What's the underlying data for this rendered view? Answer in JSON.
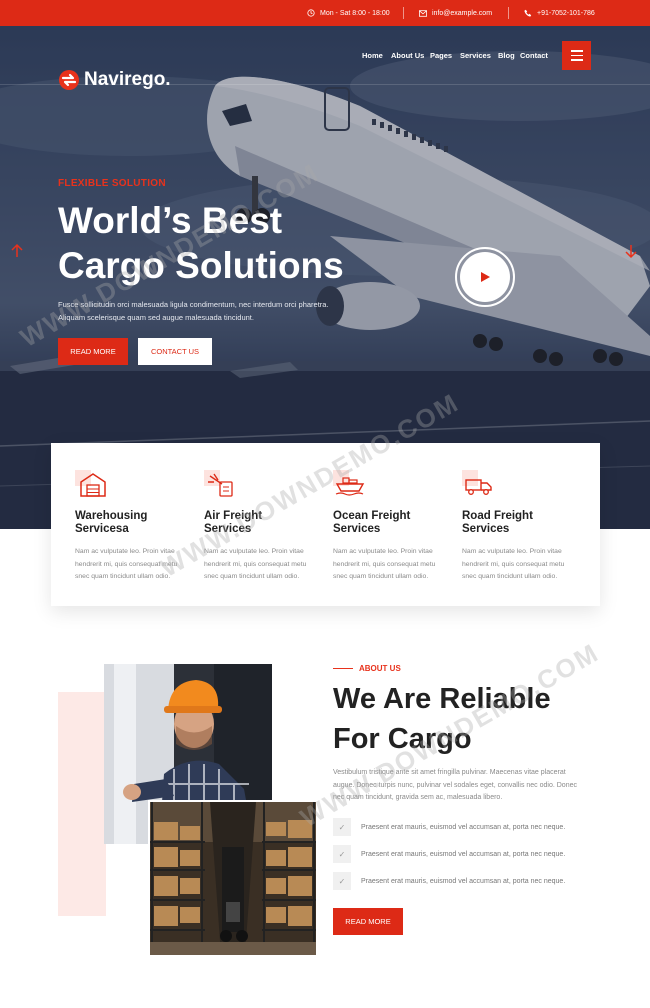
{
  "topbar": {
    "hours": "Mon - Sat 8:00 - 18:00",
    "email": "info@example.com",
    "phone": "+91-7052-101-786"
  },
  "brand": {
    "name": "Navirego."
  },
  "nav": {
    "items": [
      "Home",
      "About Us",
      "Pages",
      "Services",
      "Blog",
      "Contact"
    ]
  },
  "hero": {
    "kicker": "FLEXIBLE SOLUTION",
    "title_line1": "World’s Best",
    "title_line2": "Cargo Solutions",
    "desc_line1": "Fusce sollicitudin orci malesuada ligula condimentum, nec interdum orci pharetra.",
    "desc_line2": "Aliquam scelerisque quam sed augue malesuada tincidunt.",
    "btn_primary": "READ MORE",
    "btn_secondary": "CONTACT US"
  },
  "services": [
    {
      "title_line1": "Warehousing",
      "title_line2": "Servicesa",
      "icon": "warehouse-icon",
      "desc": [
        "Nam ac vulputate leo. Proin vitae",
        "hendrerit mi, quis consequat metu",
        "snec quam tincidunt ullam odio."
      ]
    },
    {
      "title_line1": "Air Freight",
      "title_line2": "Services",
      "icon": "air-freight-icon",
      "desc": [
        "Nam ac vulputate leo. Proin vitae",
        "hendrerit mi, quis consequat metu",
        "snec quam tincidunt ullam odio."
      ]
    },
    {
      "title_line1": "Ocean Freight",
      "title_line2": "Services",
      "icon": "ship-icon",
      "desc": [
        "Nam ac vulputate leo. Proin vitae",
        "hendrerit mi, quis consequat metu",
        "snec quam tincidunt ullam odio."
      ]
    },
    {
      "title_line1": "Road Freight",
      "title_line2": "Services",
      "icon": "truck-icon",
      "desc": [
        "Nam ac vulputate leo. Proin vitae",
        "hendrerit mi, quis consequat metu",
        "snec quam tincidunt ullam odio."
      ]
    }
  ],
  "about": {
    "kicker": "ABOUT US",
    "title_line1": "We Are Reliable",
    "title_line2": "For Cargo",
    "desc_line1": "Vestibulum tristique ante sit amet fringilla pulvinar. Maecenas vitae placerat",
    "desc_line2": "augue. Donec turpis nunc, pulvinar vel sodales eget, convallis nec odio. Donec",
    "desc_line3": "nec quam tincidunt, gravida sem ac, malesuada libero.",
    "checks": [
      "Praesent erat mauris, euismod vel accumsan at, porta nec neque.",
      "Praesent erat mauris, euismod vel accumsan at, porta nec neque.",
      "Praesent erat mauris, euismod vel accumsan at, porta nec neque."
    ],
    "btn": "READ MORE"
  },
  "watermark": "WWW.DOWNDEMO.COM",
  "colors": {
    "accent": "#dd2a16",
    "dark": "#222222",
    "muted": "#8a8a8a"
  }
}
